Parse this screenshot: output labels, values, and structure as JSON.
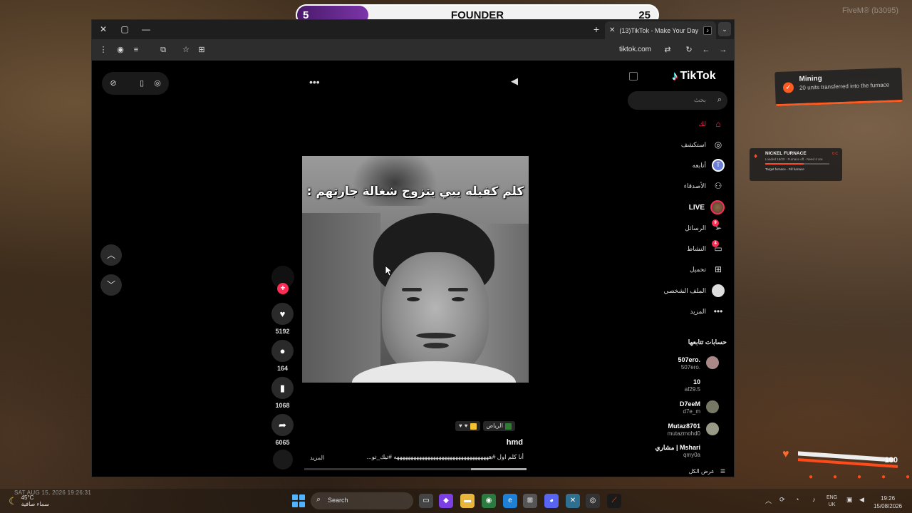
{
  "hud": {
    "score_left": "5",
    "score_title": "FOUNDER",
    "score_right": "25",
    "fivem_tag": "FiveM® (b3095)",
    "notification": {
      "title": "Mining",
      "subtitle": "20 units transferred into the furnace"
    },
    "furnace": {
      "title": "NICKEL FURNACE",
      "state": "0 C",
      "line": "Loaded 18/20 · Furnace off · Need 4 ore",
      "action": "Target furnace - Fill furnace"
    },
    "health_value": "100"
  },
  "browser": {
    "tab_title": "(13)TikTok - Make Your Day",
    "url": "tiktok.com"
  },
  "video": {
    "caption": "كلم كفيله يبي يتزوج شغالة جارتهم :",
    "likes": "5192",
    "comments": "164",
    "saves": "1068",
    "shares": "6065",
    "location_tag": "الرياض",
    "author": "hmd",
    "description": "أنا كلم اول #ههههههههههههههههههههههههههههههههههه #تيك_تو...",
    "more": "المزيد",
    "progress_fraction": 0.25
  },
  "sidebar": {
    "logo": "TikTok",
    "search_placeholder": "بحث",
    "nav": [
      {
        "label": "لك",
        "icon": "home-icon"
      },
      {
        "label": "استكشف",
        "icon": "compass-icon"
      },
      {
        "label": "أتابعه",
        "icon": "following-avatar-icon"
      },
      {
        "label": "الأصدقاء",
        "icon": "friends-icon"
      },
      {
        "label": "LIVE",
        "icon": "live-icon"
      },
      {
        "label": "الرسائل",
        "icon": "messages-icon",
        "badge": "9"
      },
      {
        "label": "النشاط",
        "icon": "activity-icon",
        "badge": "4"
      },
      {
        "label": "تحميل",
        "icon": "upload-icon"
      },
      {
        "label": "الملف الشخصي",
        "icon": "profile-icon"
      },
      {
        "label": "المزيد",
        "icon": "more-icon"
      }
    ],
    "following_heading": "حسابات تتابعها",
    "accounts": [
      {
        "name": "507ero.",
        "handle": "507ero."
      },
      {
        "name": "10",
        "handle": "af29.5"
      },
      {
        "name": "D7eeM",
        "handle": "d7e_m"
      },
      {
        "name": "Mutaz8701",
        "handle": "mutazmohd0"
      },
      {
        "name": "مشاري | Mshari",
        "handle": "qmy0a"
      }
    ],
    "see_all": "عرض الكل"
  },
  "taskbar": {
    "datestamp": "SAT AUG 15, 2026 19:26:31",
    "weather_temp": "45°C",
    "weather_condition": "سماء صافية",
    "search_label": "Search",
    "lang_top": "ENG",
    "lang_bottom": "UK",
    "time": "19:26",
    "date": "15/08/2026"
  },
  "colors": {
    "tiktok_red": "#fe2c55",
    "hud_orange": "#ff5a1f",
    "score_purple": "#7b35a8"
  }
}
